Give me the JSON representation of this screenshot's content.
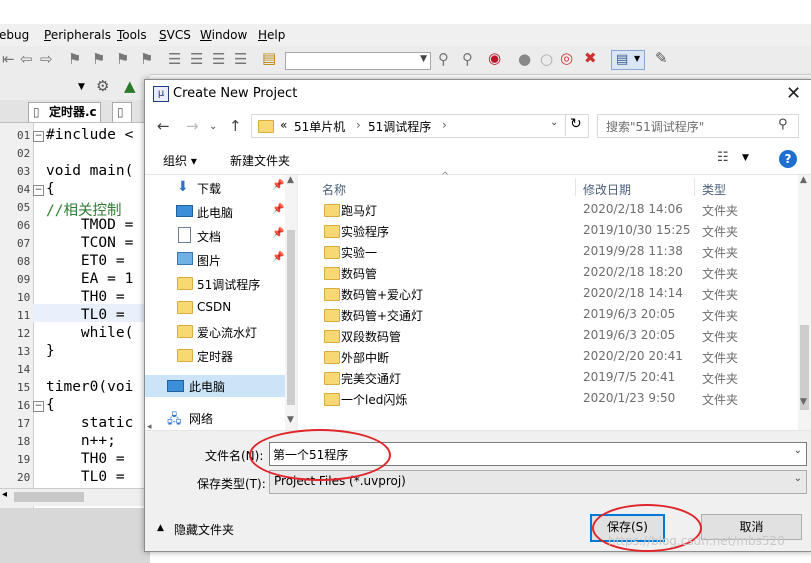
{
  "ide": {
    "menu": [
      {
        "label": "Debug",
        "mnemonic": "D",
        "rest": "ebug"
      },
      {
        "label": "Peripherals",
        "mnemonic": "P",
        "rest": "eripherals"
      },
      {
        "label": "Tools",
        "mnemonic": "T",
        "rest": "ools"
      },
      {
        "label": "SVCS",
        "mnemonic": "S",
        "rest": "VCS"
      },
      {
        "label": "Window",
        "mnemonic": "W",
        "rest": "indow"
      },
      {
        "label": "Help",
        "mnemonic": "H",
        "rest": "elp"
      }
    ],
    "menu_visible": {
      "debug": "ebug",
      "p": "P",
      "peripherals": "eripherals",
      "t": "T",
      "tools": "ools",
      "s": "S",
      "svcs": "VCS",
      "w": "W",
      "window": "indow",
      "h": "H",
      "help": "elp"
    },
    "tabs": {
      "active": "定时器.c"
    },
    "line_numbers": [
      "01",
      "02",
      "03",
      "04",
      "05",
      "06",
      "07",
      "08",
      "09",
      "10",
      "11",
      "12",
      "13",
      "14",
      "15",
      "16",
      "17",
      "18",
      "19",
      "20"
    ],
    "code_lines": [
      "#include <",
      "",
      "void main(",
      "{",
      "//相关控制",
      "    TMOD =",
      "    TCON =",
      "    ET0 =",
      "    EA = 1",
      "    TH0 =",
      "    TL0 =",
      "    while(",
      "}",
      "",
      "timer0(voi",
      "{",
      "    static",
      "    n++;",
      "    TH0 =",
      "    TL0 ="
    ]
  },
  "dialog": {
    "title": "Create New Project",
    "breadcrumb": {
      "prefix": "«",
      "items": [
        "51单片机",
        "51调试程序"
      ]
    },
    "search_placeholder": "搜索\"51调试程序\"",
    "organize": "组织 ▾",
    "new_folder": "新建文件夹",
    "nav_items": [
      {
        "label": "下载",
        "icon": "download-icon",
        "pinned": true
      },
      {
        "label": "此电脑",
        "icon": "computer-icon",
        "pinned": true
      },
      {
        "label": "文档",
        "icon": "document-icon",
        "pinned": true
      },
      {
        "label": "图片",
        "icon": "picture-icon",
        "pinned": true
      },
      {
        "label": "51调试程序",
        "icon": "folder-icon",
        "pinned": false
      },
      {
        "label": "CSDN",
        "icon": "folder-icon",
        "pinned": false
      },
      {
        "label": "爱心流水灯",
        "icon": "folder-icon",
        "pinned": false
      },
      {
        "label": "定时器",
        "icon": "folder-icon",
        "pinned": false
      },
      {
        "label": "此电脑",
        "icon": "computer-icon",
        "pinned": false,
        "selected": true
      },
      {
        "label": "网络",
        "icon": "network-icon",
        "pinned": false
      }
    ],
    "columns": {
      "name": "名称",
      "date": "修改日期",
      "type": "类型"
    },
    "files": [
      {
        "name": "跑马灯",
        "date": "2020/2/18 14:06",
        "type": "文件夹"
      },
      {
        "name": "实验程序",
        "date": "2019/10/30 15:25",
        "type": "文件夹"
      },
      {
        "name": "实验一",
        "date": "2019/9/28 11:38",
        "type": "文件夹"
      },
      {
        "name": "数码管",
        "date": "2020/2/18 18:20",
        "type": "文件夹"
      },
      {
        "name": "数码管+爱心灯",
        "date": "2020/2/18 14:14",
        "type": "文件夹"
      },
      {
        "name": "数码管+交通灯",
        "date": "2019/6/3 20:05",
        "type": "文件夹"
      },
      {
        "name": "双段数码管",
        "date": "2019/6/3 20:05",
        "type": "文件夹"
      },
      {
        "name": "外部中断",
        "date": "2020/2/20 20:41",
        "type": "文件夹"
      },
      {
        "name": "完美交通灯",
        "date": "2019/7/5 20:41",
        "type": "文件夹"
      },
      {
        "name": "一个led闪烁",
        "date": "2020/1/23 9:50",
        "type": "文件夹"
      }
    ],
    "filename_label": "文件名(N):",
    "filename_value": "第一个51程序",
    "filetype_label": "保存类型(T):",
    "filetype_value": "Project Files (*.uvproj)",
    "hide_folders": "隐藏文件夹",
    "save_button": "保存(S)",
    "cancel_button": "取消"
  },
  "watermark": "https://blog.csdn.net/mbs520",
  "colors": {
    "annotation_red": "#e0252b",
    "accent_blue": "#0078d7"
  }
}
